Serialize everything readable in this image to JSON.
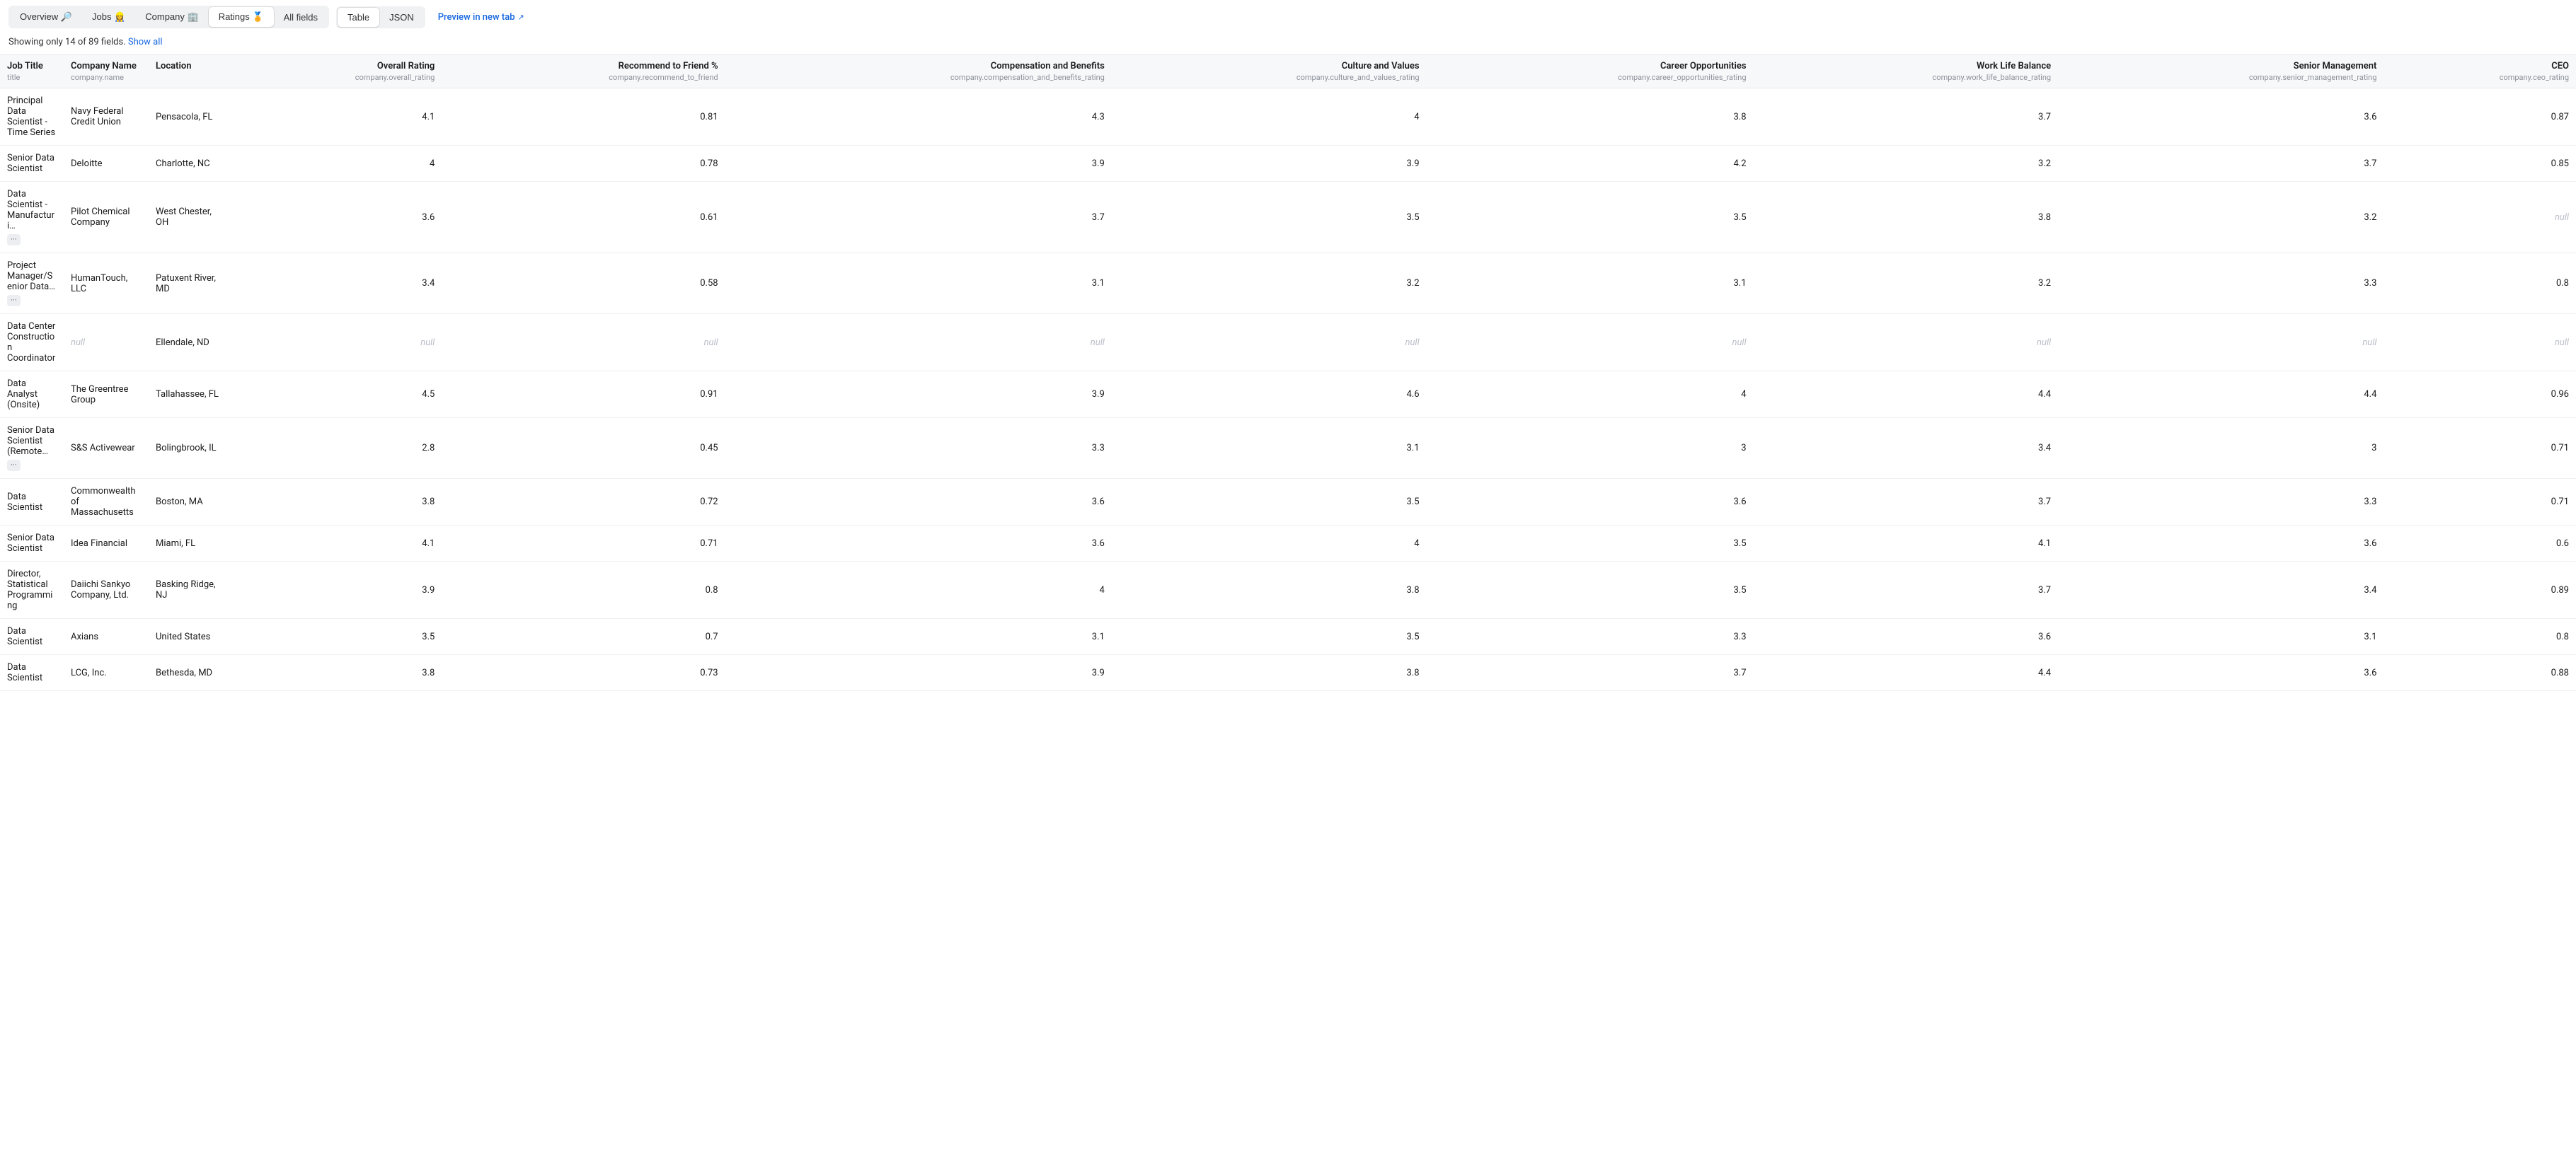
{
  "toolbar": {
    "groups": [
      {
        "items": [
          {
            "label": "Overview",
            "emoji": "🔎",
            "active": false
          },
          {
            "label": "Jobs",
            "emoji": "👷‍♀️",
            "active": false
          },
          {
            "label": "Company",
            "emoji": "🏢",
            "active": false
          },
          {
            "label": "Ratings",
            "emoji": "🏅",
            "active": true
          },
          {
            "label": "All fields",
            "emoji": "",
            "active": false
          }
        ]
      },
      {
        "items": [
          {
            "label": "Table",
            "emoji": "",
            "active": true
          },
          {
            "label": "JSON",
            "emoji": "",
            "active": false
          }
        ]
      }
    ],
    "preview_label": "Preview in new tab"
  },
  "info": {
    "text": "Showing only 14 of 89 fields. ",
    "show_all": "Show all"
  },
  "columns": [
    {
      "label": "Job Title",
      "sub": "title",
      "type": "text"
    },
    {
      "label": "Company Name",
      "sub": "company.name",
      "type": "text"
    },
    {
      "label": "Location",
      "sub": "",
      "type": "text"
    },
    {
      "label": "Overall Rating",
      "sub": "company.overall_rating",
      "type": "num"
    },
    {
      "label": "Recommend to Friend %",
      "sub": "company.recommend_to_friend",
      "type": "num"
    },
    {
      "label": "Compensation and Benefits",
      "sub": "company.compensation_and_benefits_rating",
      "type": "num"
    },
    {
      "label": "Culture and Values",
      "sub": "company.culture_and_values_rating",
      "type": "num"
    },
    {
      "label": "Career Opportunities",
      "sub": "company.career_opportunities_rating",
      "type": "num"
    },
    {
      "label": "Work Life Balance",
      "sub": "company.work_life_balance_rating",
      "type": "num"
    },
    {
      "label": "Senior Management",
      "sub": "company.senior_management_rating",
      "type": "num"
    },
    {
      "label": "CEO",
      "sub": "company.ceo_rating",
      "type": "num"
    }
  ],
  "rows": [
    {
      "title": "Principal Data Scientist - Time Series",
      "title_trunc": false,
      "company": "Navy Federal Credit Union",
      "company_null": false,
      "location": "Pensacola, FL",
      "vals": [
        "4.1",
        "0.81",
        "4.3",
        "4",
        "3.8",
        "3.7",
        "3.6",
        "0.87"
      ],
      "nulls": [
        false,
        false,
        false,
        false,
        false,
        false,
        false,
        false
      ]
    },
    {
      "title": "Senior Data Scientist",
      "title_trunc": false,
      "company": "Deloitte",
      "company_null": false,
      "location": "Charlotte, NC",
      "vals": [
        "4",
        "0.78",
        "3.9",
        "3.9",
        "4.2",
        "3.2",
        "3.7",
        "0.85"
      ],
      "nulls": [
        false,
        false,
        false,
        false,
        false,
        false,
        false,
        false
      ]
    },
    {
      "title": "Data Scientist - Manufacturi…",
      "title_trunc": true,
      "company": "Pilot Chemical Company",
      "company_null": false,
      "location": "West Chester, OH",
      "vals": [
        "3.6",
        "0.61",
        "3.7",
        "3.5",
        "3.5",
        "3.8",
        "3.2",
        "null"
      ],
      "nulls": [
        false,
        false,
        false,
        false,
        false,
        false,
        false,
        true
      ]
    },
    {
      "title": "Project Manager/Senior Data…",
      "title_trunc": true,
      "company": "HumanTouch, LLC",
      "company_null": false,
      "location": "Patuxent River, MD",
      "vals": [
        "3.4",
        "0.58",
        "3.1",
        "3.2",
        "3.1",
        "3.2",
        "3.3",
        "0.8"
      ],
      "nulls": [
        false,
        false,
        false,
        false,
        false,
        false,
        false,
        false
      ]
    },
    {
      "title": "Data Center Construction Coordinator",
      "title_trunc": false,
      "company": "null",
      "company_null": true,
      "location": "Ellendale, ND",
      "vals": [
        "null",
        "null",
        "null",
        "null",
        "null",
        "null",
        "null",
        "null"
      ],
      "nulls": [
        true,
        true,
        true,
        true,
        true,
        true,
        true,
        true
      ]
    },
    {
      "title": "Data Analyst (Onsite)",
      "title_trunc": false,
      "company": "The Greentree Group",
      "company_null": false,
      "location": "Tallahassee, FL",
      "vals": [
        "4.5",
        "0.91",
        "3.9",
        "4.6",
        "4",
        "4.4",
        "4.4",
        "0.96"
      ],
      "nulls": [
        false,
        false,
        false,
        false,
        false,
        false,
        false,
        false
      ]
    },
    {
      "title": "Senior Data Scientist (Remote…",
      "title_trunc": true,
      "company": "S&S Activewear",
      "company_null": false,
      "location": "Bolingbrook, IL",
      "vals": [
        "2.8",
        "0.45",
        "3.3",
        "3.1",
        "3",
        "3.4",
        "3",
        "0.71"
      ],
      "nulls": [
        false,
        false,
        false,
        false,
        false,
        false,
        false,
        false
      ]
    },
    {
      "title": "Data Scientist",
      "title_trunc": false,
      "company": "Commonwealth of Massachusetts",
      "company_null": false,
      "location": "Boston, MA",
      "vals": [
        "3.8",
        "0.72",
        "3.6",
        "3.5",
        "3.6",
        "3.7",
        "3.3",
        "0.71"
      ],
      "nulls": [
        false,
        false,
        false,
        false,
        false,
        false,
        false,
        false
      ]
    },
    {
      "title": "Senior Data Scientist",
      "title_trunc": false,
      "company": "Idea Financial",
      "company_null": false,
      "location": "Miami, FL",
      "vals": [
        "4.1",
        "0.71",
        "3.6",
        "4",
        "3.5",
        "4.1",
        "3.6",
        "0.6"
      ],
      "nulls": [
        false,
        false,
        false,
        false,
        false,
        false,
        false,
        false
      ]
    },
    {
      "title": "Director, Statistical Programming",
      "title_trunc": false,
      "company": "Daiichi Sankyo Company, Ltd.",
      "company_null": false,
      "location": "Basking Ridge, NJ",
      "vals": [
        "3.9",
        "0.8",
        "4",
        "3.8",
        "3.5",
        "3.7",
        "3.4",
        "0.89"
      ],
      "nulls": [
        false,
        false,
        false,
        false,
        false,
        false,
        false,
        false
      ]
    },
    {
      "title": "Data Scientist",
      "title_trunc": false,
      "company": "Axians",
      "company_null": false,
      "location": "United States",
      "vals": [
        "3.5",
        "0.7",
        "3.1",
        "3.5",
        "3.3",
        "3.6",
        "3.1",
        "0.8"
      ],
      "nulls": [
        false,
        false,
        false,
        false,
        false,
        false,
        false,
        false
      ]
    },
    {
      "title": "Data Scientist",
      "title_trunc": false,
      "company": "LCG, Inc.",
      "company_null": false,
      "location": "Bethesda, MD",
      "vals": [
        "3.8",
        "0.73",
        "3.9",
        "3.8",
        "3.7",
        "4.4",
        "3.6",
        "0.88"
      ],
      "nulls": [
        false,
        false,
        false,
        false,
        false,
        false,
        false,
        false
      ]
    }
  ]
}
